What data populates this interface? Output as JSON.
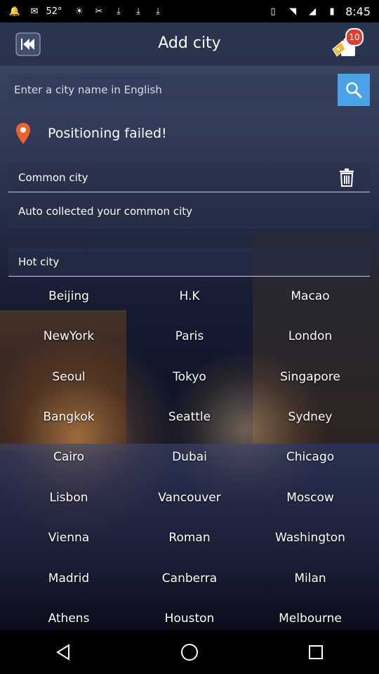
{
  "status_bar": {
    "time": "8:45",
    "battery": "52°",
    "left_icons": [
      "bell-icon",
      "mail-icon",
      "temp-icon",
      "sun-icon",
      "tools-icon",
      "download-icon",
      "download-icon",
      "download-icon"
    ],
    "right_icons": [
      "vibrate-icon",
      "wifi-icon",
      "signal-icon",
      "battery-icon"
    ]
  },
  "header": {
    "title": "Add city",
    "cart_badge": "10"
  },
  "search": {
    "placeholder": "Enter a city name in English"
  },
  "location": {
    "text": "Positioning failed!"
  },
  "common_city": {
    "label": "Common city",
    "body": "Auto collected your common city"
  },
  "hot_city": {
    "label": "Hot city",
    "rows": [
      [
        "Beijing",
        "H.K",
        "Macao"
      ],
      [
        "NewYork",
        "Paris",
        "London"
      ],
      [
        "Seoul",
        "Tokyo",
        "Singapore"
      ],
      [
        "Bangkok",
        "Seattle",
        "Sydney"
      ],
      [
        "Cairo",
        "Dubai",
        "Chicago"
      ],
      [
        "Lisbon",
        "Vancouver",
        "Moscow"
      ],
      [
        "Vienna",
        "Roman",
        "Washington"
      ],
      [
        "Madrid",
        "Canberra",
        "Milan"
      ],
      [
        "Athens",
        "Houston",
        "Melbourne"
      ]
    ]
  },
  "colors": {
    "accent": "#4aa3e8",
    "badge": "#e53c2f",
    "pin": "#f0602a"
  }
}
